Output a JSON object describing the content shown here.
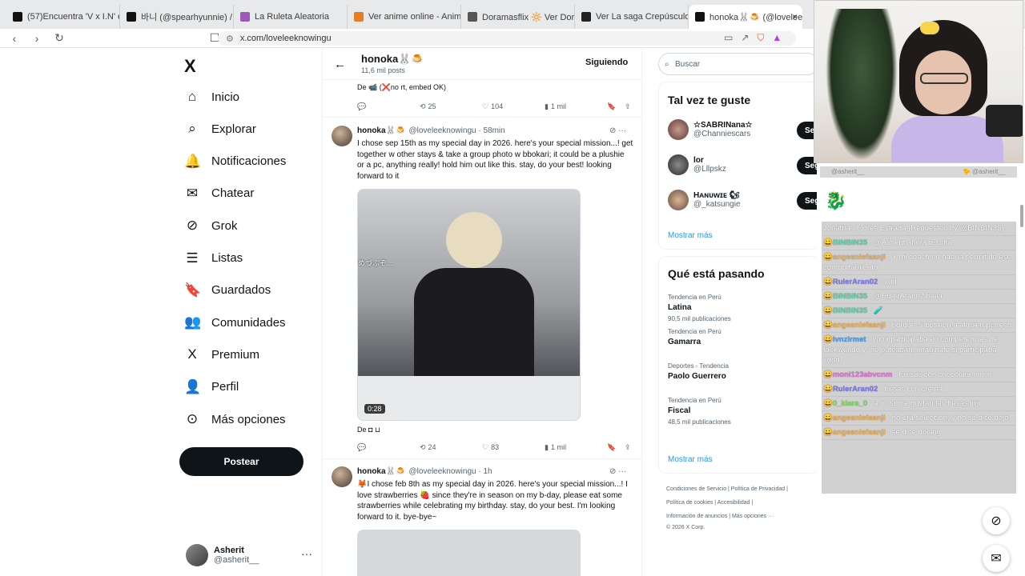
{
  "browser": {
    "tabs": [
      {
        "title": "(57)Encuentra 'V x I.N' en TikTok",
        "fav": "tiktok",
        "color": "#111111"
      },
      {
        "title": "바니 (@spearhyunnie) / X",
        "fav": "x",
        "color": "#111111"
      },
      {
        "title": "La Ruleta Aleatoria",
        "fav": "wheel",
        "color": "#9b59b6"
      },
      {
        "title": "Ver anime online - AnimeFénix",
        "fav": "anime",
        "color": "#e67e22"
      },
      {
        "title": "Doramasflix 🔆 Ver Doramas O",
        "fav": "globe",
        "color": "#555555"
      },
      {
        "title": "Ver La saga Crepúsculo: Luna n",
        "fav": "hd",
        "color": "#222222"
      },
      {
        "title": "honoka🐰🍮 (@loveleekno",
        "fav": "x",
        "color": "#111111"
      }
    ],
    "close_label": "×",
    "url": "x.com/loveleeknowingu"
  },
  "nav": {
    "logo": "X",
    "items": [
      {
        "label": "Inicio",
        "icon": "⌂"
      },
      {
        "label": "Explorar",
        "icon": "⌕"
      },
      {
        "label": "Notificaciones",
        "icon": "🔔"
      },
      {
        "label": "Chatear",
        "icon": "✉"
      },
      {
        "label": "Grok",
        "icon": "⊘"
      },
      {
        "label": "Listas",
        "icon": "☰"
      },
      {
        "label": "Guardados",
        "icon": "🔖"
      },
      {
        "label": "Comunidades",
        "icon": "👥"
      },
      {
        "label": "Premium",
        "icon": "X"
      },
      {
        "label": "Perfil",
        "icon": "👤"
      },
      {
        "label": "Más opciones",
        "icon": "⊙"
      }
    ],
    "post_button": "Postear",
    "user_name": "Asherit",
    "user_handle": "@asherit__",
    "user_more": "···"
  },
  "profile": {
    "name": "honoka🐰🍮",
    "posts": "11,6 mil posts",
    "follow_label": "Siguiendo"
  },
  "tweets": [
    {
      "credit": "De 📹 (❌no rt, embed OK)",
      "retweets": "25",
      "likes": "104",
      "views": "1 mil"
    },
    {
      "name": "honoka🐰🍮",
      "handle": "@loveleeknowingu · 58min",
      "text": "I chose sep 15th as my special day in 2026. here's your special mission...! get together w other stays & take a group photo w bbokari; it could be a plushie or a pc, anything really! hold him out like this. stay, do your best! looking forward to it",
      "video_duration": "0:28",
      "video_caption": "めづぶぞ...",
      "credit": "De ◘ ⊔",
      "retweets": "24",
      "likes": "83",
      "views": "1 mil"
    },
    {
      "name": "honoka🐰🍮",
      "handle": "@loveleeknowingu · 1h",
      "text": "🦊I chose feb 8th as my special day in 2026. here's your special mission...! I love strawberries 🍓 since they're in season on my b-day, please eat some strawberries while celebrating my birthday. stay, do your best. I'm looking forward to it. bye-bye~"
    }
  ],
  "right": {
    "search_placeholder": "Buscar",
    "suggest_title": "Tal vez te guste",
    "suggestions": [
      {
        "name": "☆SABRINana☆",
        "handle": "@Channiescars",
        "btn": "Se"
      },
      {
        "name": "lor",
        "handle": "@Lllpskz",
        "btn": "Seguir"
      },
      {
        "name": "Hᴀɴᴜᴡɪᴇ 🐿",
        "handle": "@_katsungie",
        "btn": "Seguir"
      }
    ],
    "show_more": "Mostrar más",
    "trends_title": "Qué está pasando",
    "trends": [
      {
        "context": "Tendencia en Perú",
        "topic": "Latina",
        "count": "90,5 mil publicaciones"
      },
      {
        "context": "Tendencia en Perú",
        "topic": "Gamarra",
        "count": ""
      },
      {
        "context": "Deportes · Tendencia",
        "topic": "Paolo Guerrero",
        "count": ""
      },
      {
        "context": "Tendencia en Perú",
        "topic": "Fiscal",
        "count": "48,5 mil publicaciones"
      }
    ],
    "footer": [
      "Condiciones de Servicio | Política de Privacidad |",
      "Política de cookies | Accesibilidad |",
      "Información de anuncios | Más opciones ···",
      "© 2026 X Corp."
    ]
  },
  "stream": {
    "chat_strip_left": "@asherit__",
    "chat_strip_right": "🐤 @asherit__",
    "messages": [
      {
        "user": "",
        "text": "Jonathan Flores Estrada (Requested by @BINBIN35)",
        "color": "#ffffff"
      },
      {
        "user": "BINBIN35",
        "text": ": @Asherit ahora resulta",
        "color": "#5fd4a8"
      },
      {
        "user": "angesniefaanji",
        "text": ": Y mi coach no habría permitido ese comportamiento",
        "color": "#f0b35a"
      },
      {
        "user": "RulerAran02",
        "text": ": xdd",
        "color": "#7b7bf5"
      },
      {
        "user": "BINBIN35",
        "text": ": @RulerAran02 baila",
        "color": "#5fd4a8"
      },
      {
        "user": "BINBIN35",
        "text": ": 🧪",
        "color": "#5fd4a8"
      },
      {
        "user": "angesniefaanji",
        "text": ": porque si botaron a alguien por eso",
        "color": "#f0b35a"
      },
      {
        "user": "lvnzlrmet",
        "text": ": yo ni participaba en competencias de taekwondo y me puteaban, imaginate si participaba xddd",
        "color": "#4aa0f0"
      },
      {
        "user": "moni123abvcnm",
        "text": ": Fresas con chocolate mmm",
        "color": "#e86fd6"
      },
      {
        "user": "RulerAran02",
        "text": ": fresas con crema",
        "color": "#7b7bf5"
      },
      {
        "user": "0_kiara_0",
        "text": ": a mi si me gustan las fresas jiijji",
        "color": "#7fe05a"
      },
      {
        "user": "angesniefaanji",
        "text": ": no era selección, y no se dice dojo",
        "color": "#f0b35a"
      },
      {
        "user": "angesniefaanji",
        "text": ": se dice dojang",
        "color": "#f0b35a"
      }
    ]
  }
}
